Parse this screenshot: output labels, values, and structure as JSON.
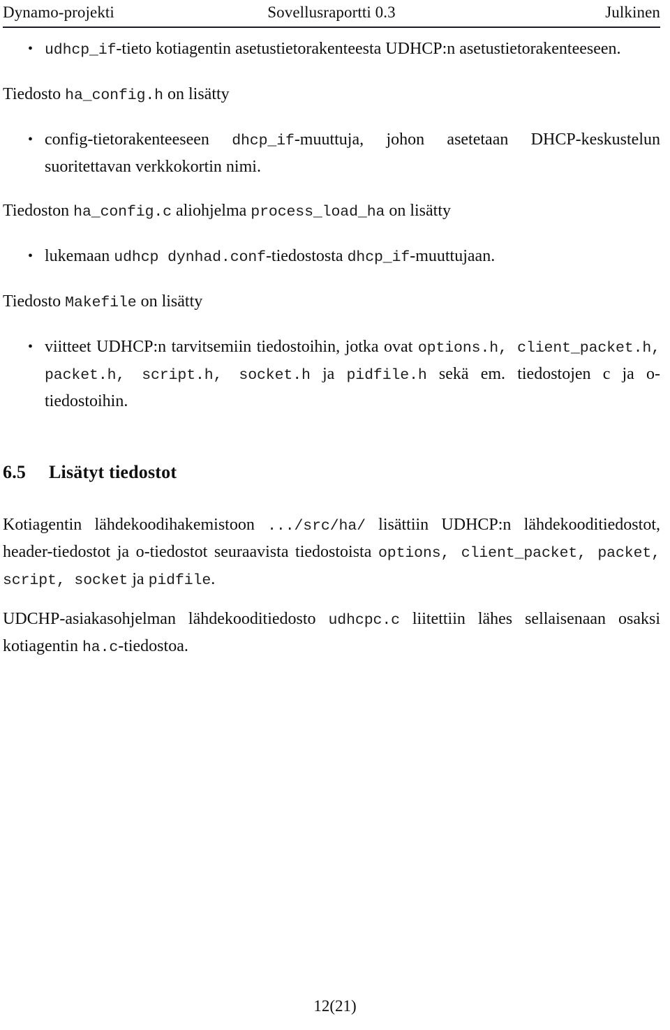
{
  "header": {
    "left": "Dynamo-projekti",
    "center": "Sovellusraportti 0.3",
    "right": "Julkinen"
  },
  "footer": {
    "page_number": "12(21)"
  },
  "content": {
    "bullet_1": {
      "code_1": "udhcp_if",
      "text_1": "-tieto kotiagentin asetustietorakenteesta UDHCP:n asetustietorakenteeseen."
    },
    "para_1": {
      "text_1": "Tiedosto ",
      "code_1": "ha_config.h",
      "text_2": " on lisätty"
    },
    "bullet_2": {
      "text_1": "config-tietorakenteeseen ",
      "code_1": "dhcp_if",
      "text_2": "-muuttuja, johon asetetaan DHCP-keskustelun suoritettavan verkkokortin nimi."
    },
    "para_2": {
      "text_1": "Tiedoston ",
      "code_1": "ha_config.c",
      "text_2": " aliohjelma ",
      "code_2": "process_load_ha",
      "text_3": " on lisätty"
    },
    "bullet_3": {
      "text_1": "lukemaan ",
      "code_1": "udhcp dynhad.conf",
      "text_2": "-tiedostosta ",
      "code_2": "dhcp_if",
      "text_3": "-muuttujaan."
    },
    "para_3": {
      "text_1": "Tiedosto ",
      "code_1": "Makefile",
      "text_2": " on lisätty"
    },
    "bullet_4": {
      "text_1": "viitteet UDHCP:n tarvitsemiin tiedostoihin, jotka ovat ",
      "code_1": "options.h, client_packet.h, packet.h, script.h, socket.h",
      "text_2": " ja ",
      "code_2": "pidfile.h",
      "text_3": " sekä em. tiedostojen c ja o-tiedostoihin."
    },
    "section": {
      "number": "6.5",
      "title": "Lisätyt tiedostot"
    },
    "para_4": {
      "text_1": "Kotiagentin lähdekoodihakemistoon ",
      "code_1": ".../src/ha/",
      "text_2": " lisättiin UDHCP:n lähdekooditiedostot, header-tiedostot ja o-tiedostot seuraavista tiedostoista ",
      "code_2": "options, client_packet, packet, script, socket",
      "text_3": " ja ",
      "code_3": "pidfile",
      "text_4": "."
    },
    "para_5": {
      "text_1": "UDCHP-asiakasohjelman lähdekooditiedosto ",
      "code_1": "udhcpc.c",
      "text_2": " liitettiin lähes sellaisenaan osaksi kotiagentin ",
      "code_2": "ha.c",
      "text_3": "-tiedostoa."
    }
  }
}
